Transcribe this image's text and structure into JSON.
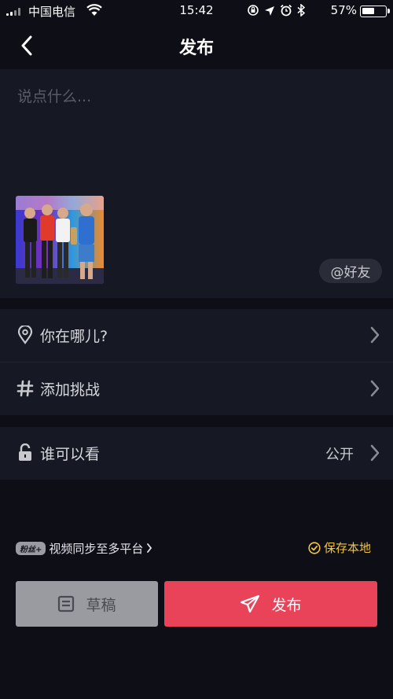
{
  "status_bar": {
    "carrier": "中国电信",
    "time": "15:42",
    "battery_percent": "57%",
    "battery_level": 0.57
  },
  "header": {
    "title": "发布",
    "back_icon": "chevron-left-icon"
  },
  "compose": {
    "placeholder": "说点什么...",
    "mention_label": "@好友"
  },
  "options": [
    {
      "label": "你在哪儿?",
      "icon": "location-pin-icon"
    },
    {
      "label": "添加挑战",
      "icon": "hashtag-icon"
    },
    {
      "label": "谁可以看",
      "icon": "unlock-icon",
      "value": "公开"
    }
  ],
  "sync": {
    "badge": "粉丝+",
    "label": "视频同步至多平台"
  },
  "save_local": {
    "label": "保存本地"
  },
  "actions": {
    "draft_label": "草稿",
    "publish_label": "发布"
  },
  "colors": {
    "background": "#0d0e16",
    "panel": "#161823",
    "accent": "#e9435a",
    "save_local": "#f4c53c",
    "draft_button": "#9a9ba1"
  }
}
